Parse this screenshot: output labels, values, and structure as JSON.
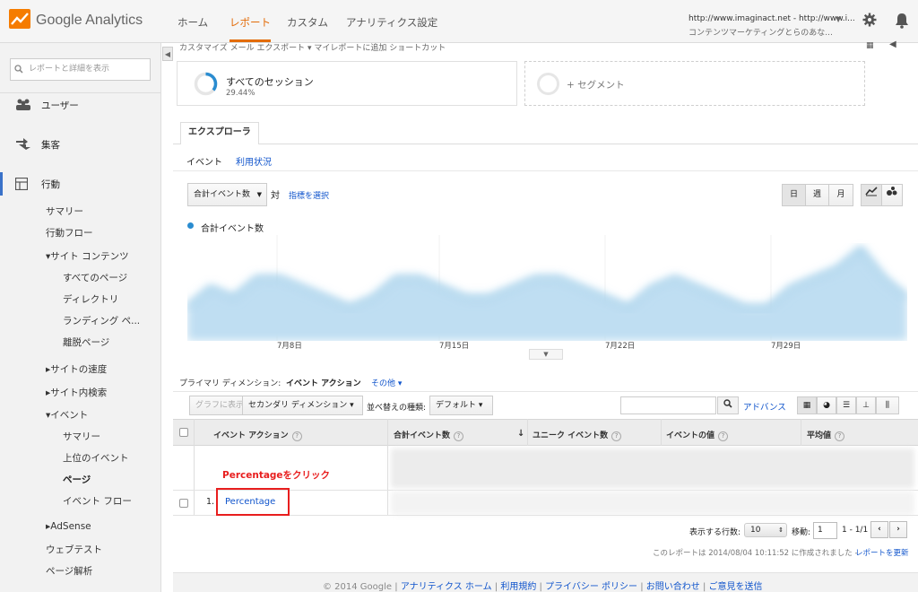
{
  "header": {
    "logo_text": "Google Analytics",
    "nav": [
      "ホーム",
      "レポート",
      "カスタム",
      "アナリティクス設定"
    ],
    "active_nav": "レポート",
    "account_line1": "http://www.imaginact.net - http://www.i...",
    "account_line2": "コンテンツマーケティングとらのあな..."
  },
  "sidebar": {
    "search_placeholder": "レポートと詳細を表示",
    "top_items": [
      "ユーザー",
      "集客",
      "行動"
    ],
    "behavior_items": {
      "summary": "サマリー",
      "flow": "行動フロー",
      "site_content": "▾サイト コンテンツ",
      "all_pages": "すべてのページ",
      "directory": "ディレクトリ",
      "landing": "ランディング ペ...",
      "exit": "離脱ページ",
      "site_speed": "▸サイトの速度",
      "site_search": "▸サイト内検索",
      "events": "▾イベント",
      "ev_summary": "サマリー",
      "ev_top": "上位のイベント",
      "ev_pages": "ページ",
      "ev_flow": "イベント フロー",
      "adsense": "▸AdSense",
      "web_test": "ウェブテスト",
      "page_analysis": "ページ解析"
    }
  },
  "toolbar": {
    "text": "カスタマイズ メール エクスポート ▾ マイレポートに追加 ショートカット"
  },
  "segments": {
    "all_sessions": "すべてのセッション",
    "pct": "29.44%",
    "add_segment": "+ セグメント"
  },
  "explorer": {
    "tab": "エクスプローラ",
    "subtabs": [
      "イベント",
      "利用状況"
    ]
  },
  "chart_controls": {
    "metric": "合計イベント数",
    "vs": "対",
    "pick_metric": "指標を選択",
    "periods": [
      "日",
      "週",
      "月"
    ]
  },
  "chart_data": {
    "type": "area",
    "series": [
      {
        "name": "合計イベント数",
        "values": [
          3,
          5,
          4,
          6,
          6,
          5,
          4,
          3,
          4,
          6,
          6,
          5,
          4,
          4,
          5,
          6,
          6,
          5,
          4,
          3,
          5,
          6,
          5,
          4,
          3,
          3,
          5,
          6,
          7,
          9,
          6,
          4
        ]
      }
    ],
    "x_ticks": [
      "7月8日",
      "7月15日",
      "7月22日",
      "7月29日"
    ],
    "legend": "top-left",
    "color": "#2a8cd0"
  },
  "dimension": {
    "label": "プライマリ ディメンション:",
    "value": "イベント アクション",
    "other": "その他 ▾"
  },
  "controls": {
    "graph": "グラフに表示",
    "secondary": "セカンダリ ディメンション ▾",
    "sort_label": "並べ替えの種類:",
    "sort_value": "デフォルト ▾",
    "advanced": "アドバンス"
  },
  "table": {
    "headers": [
      "イベント アクション",
      "合計イベント数",
      "ユニーク イベント数",
      "イベントの値",
      "平均値"
    ],
    "sort_arrow": "↓",
    "annotation": "Percentageをクリック",
    "row_num": "1.",
    "row_label": "Percentage"
  },
  "pagination": {
    "rows_label": "表示する行数:",
    "rows_value": "10",
    "goto_label": "移動:",
    "goto_value": "1",
    "range": "1 - 1/1"
  },
  "report_note": "このレポートは 2014/08/04 10:11:52 に作成されました -",
  "refresh": "レポートを更新",
  "footer": {
    "copyright": "© 2014 Google",
    "links": [
      "アナリティクス ホーム",
      "利用規約",
      "プライバシー ポリシー",
      "お問い合わせ",
      "ご意見を送信"
    ]
  }
}
